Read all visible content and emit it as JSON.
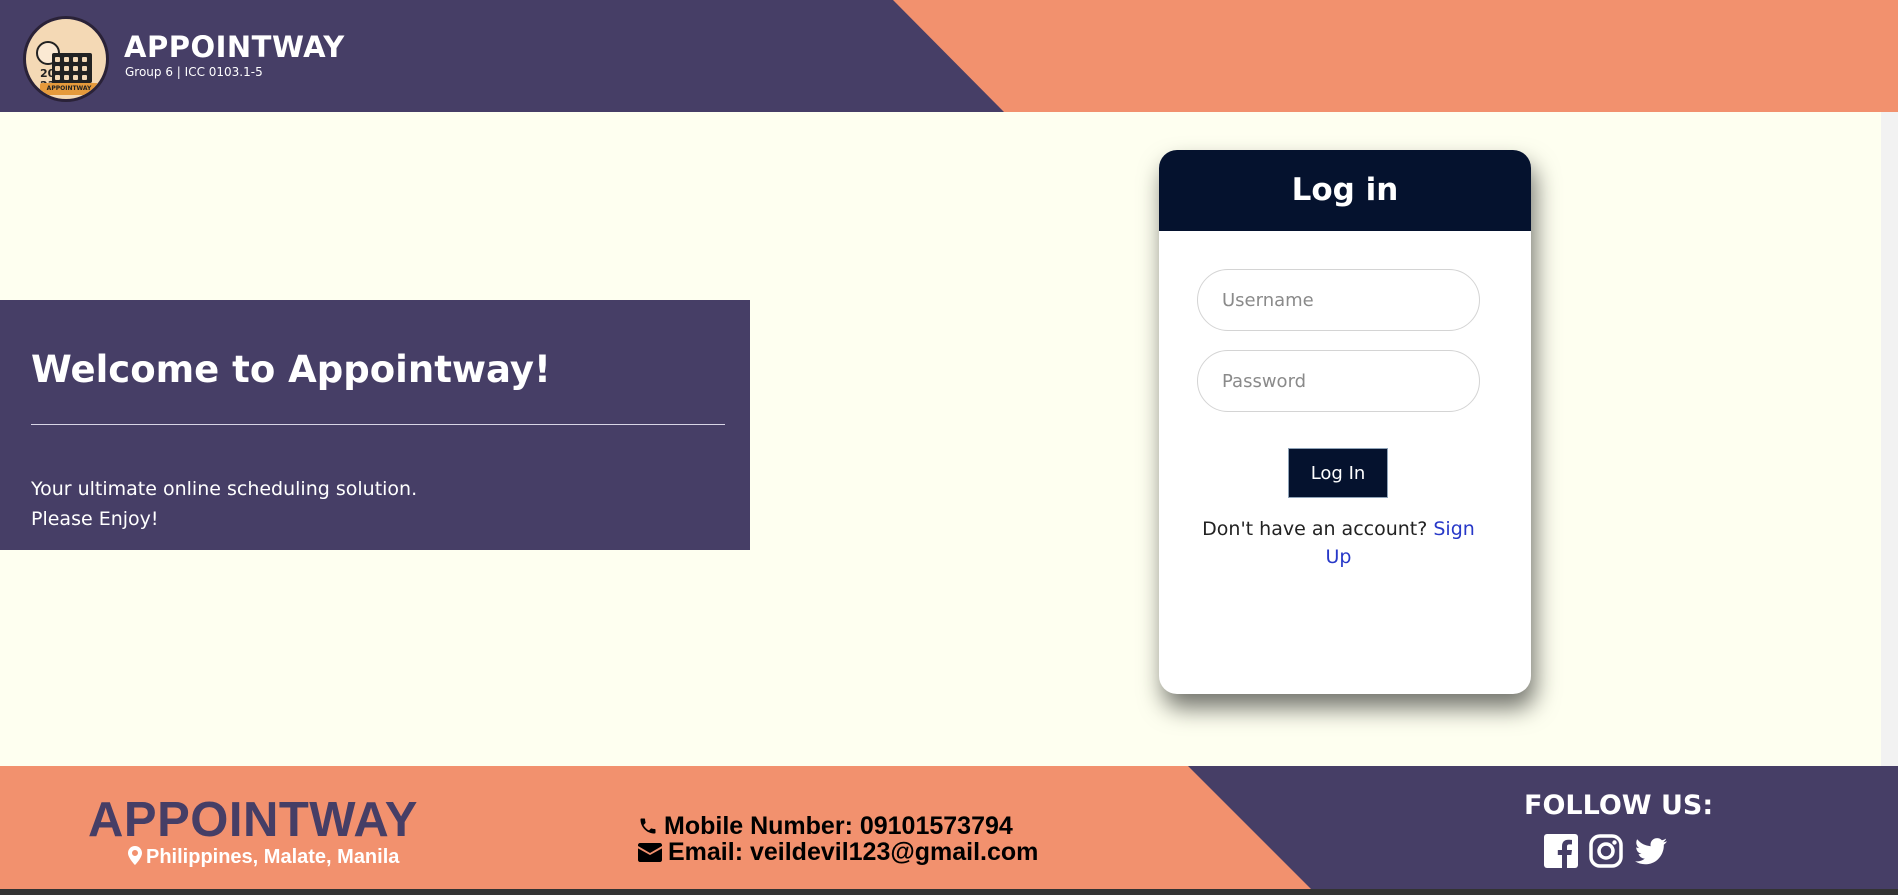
{
  "header": {
    "title": "APPOINTWAY",
    "subtitle": "Group 6 | ICC 0103.1-5",
    "logo": {
      "year_top": "20",
      "year_bottom": "23",
      "ribbon": "APPOINTWAY"
    }
  },
  "welcome": {
    "heading": "Welcome to Appointway!",
    "line1": "Your ultimate online scheduling solution.",
    "line2": "Please Enjoy!"
  },
  "login": {
    "title": "Log in",
    "username_placeholder": "Username",
    "password_placeholder": "Password",
    "button_label": "Log In",
    "signup_prompt": "Don't have an account?",
    "signup_link": "Sign Up"
  },
  "footer": {
    "brand": "APPOINTWAY",
    "location": "Philippines, Malate, Manila",
    "mobile": "Mobile Number: 09101573794",
    "email": "Email: veildevil123@gmail.com",
    "follow_label": "FOLLOW US:",
    "socials": [
      "facebook-icon",
      "instagram-icon",
      "twitter-icon"
    ]
  },
  "colors": {
    "purple": "#463e66",
    "orange": "#f2916e",
    "navy": "#05122e",
    "cream": "#fefff0",
    "link": "#2738c8"
  }
}
